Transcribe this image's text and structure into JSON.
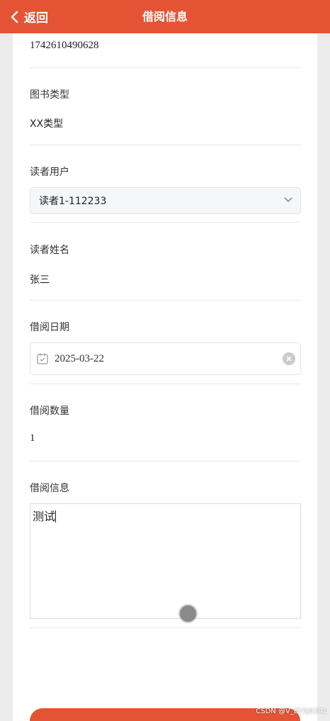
{
  "header": {
    "back_label": "返回",
    "title": "借阅信息",
    "color": "#e45434"
  },
  "form": {
    "book_id_value": "1742610490628",
    "book_type": {
      "label": "图书类型",
      "value": "XX类型"
    },
    "reader_user": {
      "label": "读者用户",
      "selected": "读者1-112233"
    },
    "reader_name": {
      "label": "读者姓名",
      "value": "张三"
    },
    "borrow_date": {
      "label": "借阅日期",
      "value": "2025-03-22"
    },
    "borrow_count": {
      "label": "借阅数量",
      "value": "1"
    },
    "borrow_info": {
      "label": "借阅信息",
      "value": "测试"
    }
  },
  "watermark": "CSDN @V_BY5J8341"
}
